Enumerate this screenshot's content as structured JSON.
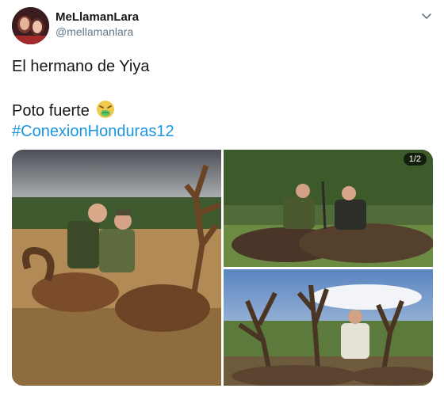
{
  "author": {
    "display_name": "MeLlamanLara",
    "handle": "@mellamanlara"
  },
  "tweet": {
    "line1": "El hermano de Yiya",
    "line2": "Poto fuerte",
    "line2_emoji": "nauseated-face-emoji",
    "hashtag": "#ConexionHonduras12"
  },
  "media": {
    "count_badge": "1/2",
    "photos": [
      "hunting-photo-deer-and-ram",
      "hunting-photo-boars",
      "hunting-photo-deer-antlers"
    ]
  },
  "colors": {
    "link": "#1b95e0",
    "text": "#14171a",
    "secondary": "#657786"
  }
}
